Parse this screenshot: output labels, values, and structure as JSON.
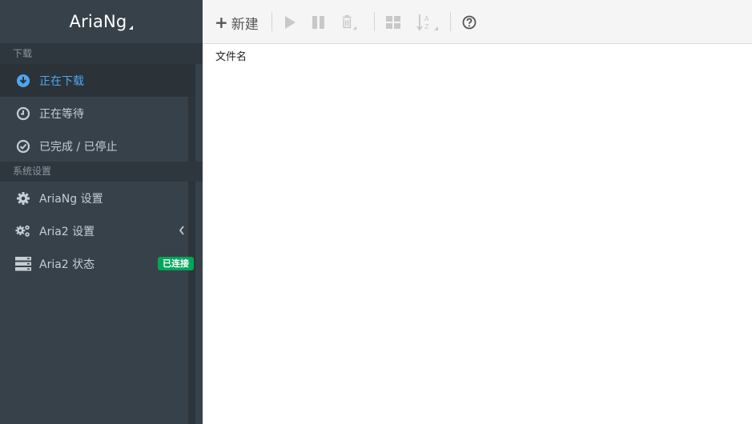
{
  "brand": {
    "title": "AriaNg"
  },
  "sidebar": {
    "sections": [
      {
        "label": "下载"
      },
      {
        "label": "系统设置"
      }
    ],
    "items": [
      {
        "label": "正在下载",
        "icon": "download-circle-icon"
      },
      {
        "label": "正在等待",
        "icon": "clock-icon"
      },
      {
        "label": "已完成 / 已停止",
        "icon": "check-circle-icon"
      },
      {
        "label": "AriaNg 设置",
        "icon": "gear-icon"
      },
      {
        "label": "Aria2 设置",
        "icon": "gears-icon"
      },
      {
        "label": "Aria2 状态",
        "icon": "server-icon",
        "badge": "已连接"
      }
    ]
  },
  "toolbar": {
    "new_label": "新建",
    "icons": [
      "play-icon",
      "pause-icon",
      "trash-icon",
      "grid-icon",
      "sort-az-icon",
      "help-icon"
    ]
  },
  "content": {
    "column_filename": "文件名"
  },
  "colors": {
    "sidebar_bg": "#374149",
    "active_text": "#4ea6f0",
    "badge_green": "#00a65a",
    "toolbar_bg": "#f5f5f5"
  }
}
